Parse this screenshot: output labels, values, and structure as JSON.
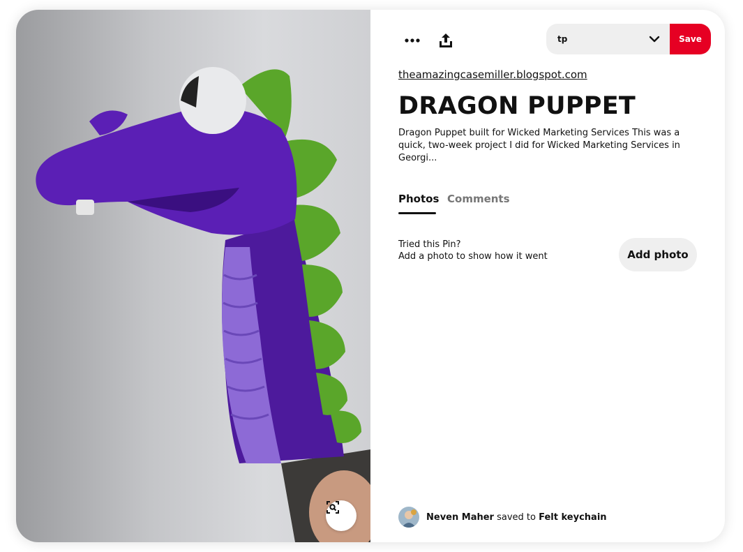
{
  "pin": {
    "image_alt": "Purple dragon puppet with green spikes",
    "source": "theamazingcasemiller.blogspot.com",
    "title": "DRAGON PUPPET",
    "description": "Dragon Puppet built for Wicked Marketing Services This was a quick, two-week project I did for Wicked Marketing Services in Georgi..."
  },
  "toolbar": {
    "more_icon": "more-horizontal-icon",
    "share_icon": "share-upload-icon",
    "board_value": "tp",
    "save_label": "Save"
  },
  "tabs": [
    {
      "label": "Photos",
      "active": true
    },
    {
      "label": "Comments",
      "active": false
    }
  ],
  "tried": {
    "line1": "Tried this Pin?",
    "line2": "Add a photo to show how it went",
    "button": "Add photo"
  },
  "saver": {
    "name": "Neven Maher",
    "action": "saved to",
    "board": "Felt keychain"
  },
  "colors": {
    "brand_red": "#e60023",
    "chip_gray": "#efefef"
  }
}
